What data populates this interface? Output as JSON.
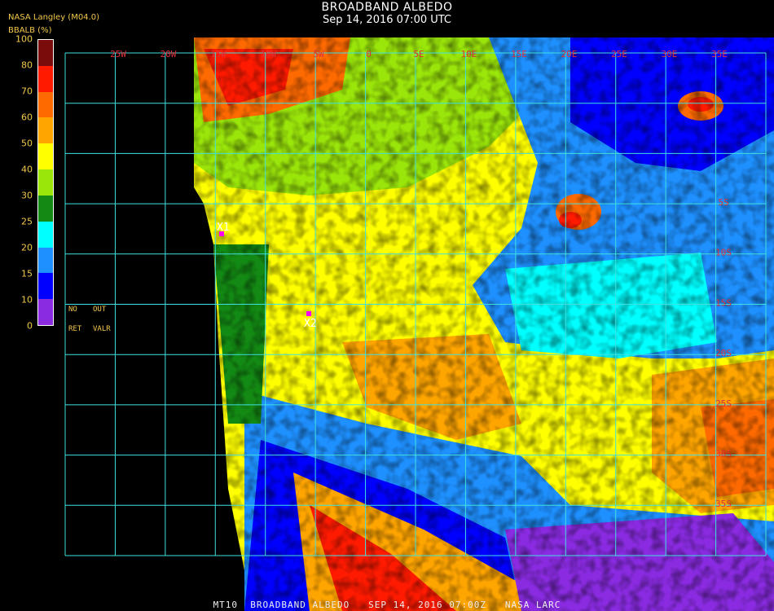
{
  "header": {
    "title": "BROADBAND ALBEDO",
    "subtitle": "Sep 14, 2016 07:00 UTC",
    "agency": "NASA Langley (M04.0)",
    "unit_label": "BBALB (%)"
  },
  "colorbar": {
    "ticks": [
      "100",
      "80",
      "70",
      "60",
      "50",
      "40",
      "30",
      "25",
      "20",
      "15",
      "10",
      "0"
    ],
    "colors": [
      "#7a0c0c",
      "#ff1a00",
      "#ff6a00",
      "#ffa500",
      "#ffff00",
      "#9be60a",
      "#138a13",
      "#00ffff",
      "#1e90ff",
      "#0000ff",
      "#8a2be2"
    ]
  },
  "legend": {
    "no_ret": "NO",
    "ret": "RET",
    "out": "OUT",
    "valr": "VALR"
  },
  "map": {
    "lon_labels": [
      "25W",
      "20W",
      "15W",
      "10W",
      "5W",
      "0",
      "5E",
      "10E",
      "15E",
      "20E",
      "25E",
      "30E",
      "35E"
    ],
    "lat_labels": [
      "5S",
      "10S",
      "15S",
      "20S",
      "25S",
      "30S",
      "35S"
    ],
    "markers": [
      {
        "label": "X1",
        "color": "#ff00ff"
      },
      {
        "label": "X2",
        "color": "#ff00ff"
      }
    ],
    "grid_color": "#3fe0e0"
  },
  "footer": "MT10  BROADBAND ALBEDO   SEP 14, 2016 07:00Z   NASA LARC"
}
